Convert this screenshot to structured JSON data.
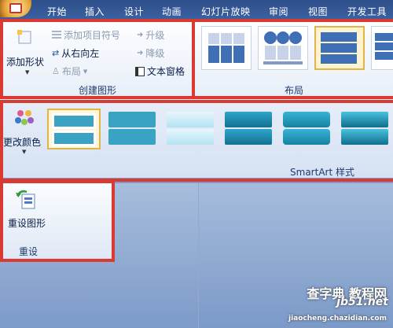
{
  "tabs": [
    "开始",
    "插入",
    "设计",
    "动画",
    "幻灯片放映",
    "审阅",
    "视图",
    "开发工具"
  ],
  "create_group": {
    "add_shape": "添加形状",
    "add_bullet": "添加项目符号",
    "rtl": "从右向左",
    "layout": "布局",
    "promote": "升级",
    "demote": "降级",
    "text_pane": "文本窗格",
    "label": "创建图形"
  },
  "layout_group": {
    "label": "布局"
  },
  "styles_group": {
    "change_colors": "更改颜色",
    "label": "SmartArt 样式"
  },
  "reset_group": {
    "reset_graphic": "重设图形",
    "label": "重设"
  },
  "watermark": {
    "line1": "查字典 教程网",
    "line2": "jb51.net",
    "line3": "jiaocheng.chazidian.com"
  },
  "colors": {
    "highlight": "#d93a32",
    "tab_bar": "#2d4f8a",
    "selected": "#e0b548"
  }
}
